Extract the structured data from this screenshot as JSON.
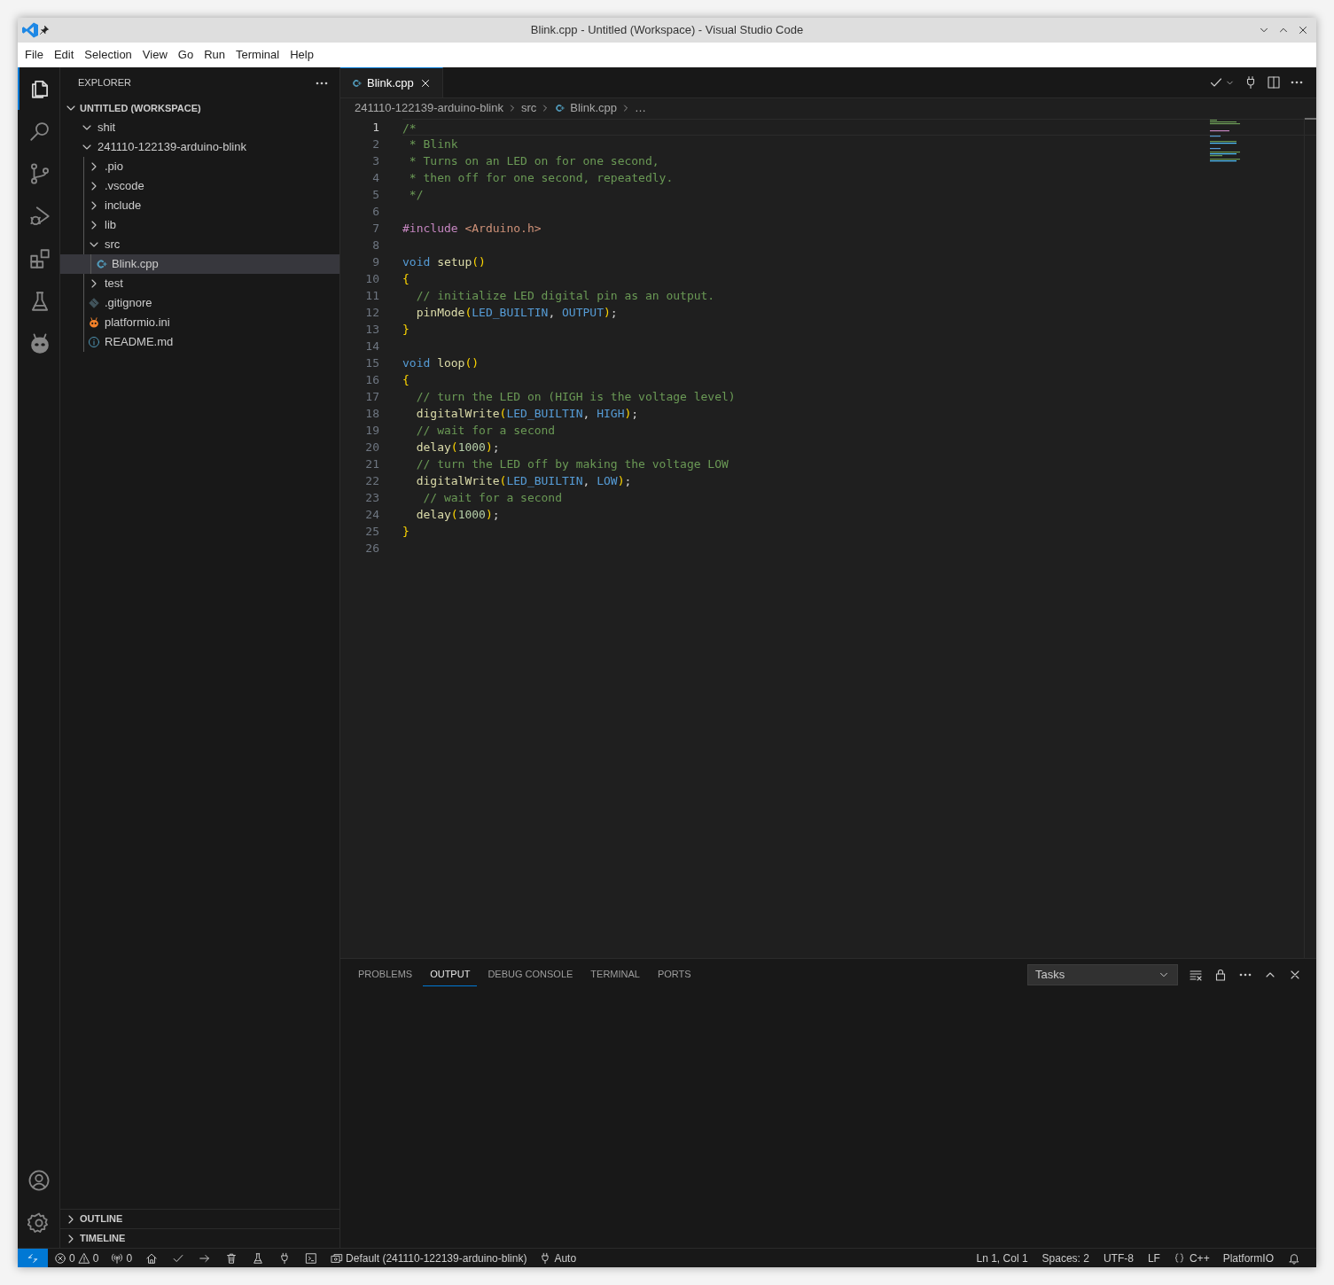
{
  "window": {
    "title": "Blink.cpp - Untitled (Workspace) - Visual Studio Code"
  },
  "menu": [
    "File",
    "Edit",
    "Selection",
    "View",
    "Go",
    "Run",
    "Terminal",
    "Help"
  ],
  "activity_bar": {
    "top": [
      {
        "selected": true
      },
      {
        "selected": false
      },
      {
        "selected": false
      },
      {
        "selected": false
      },
      {
        "selected": false
      },
      {
        "selected": false
      },
      {
        "selected": false
      }
    ]
  },
  "sidebar": {
    "title": "EXPLORER",
    "workspace": {
      "label": "UNTITLED (WORKSPACE)",
      "expanded": true
    },
    "tree": [
      {
        "label": "shit",
        "kind": "folder",
        "expanded": true,
        "selected": false
      },
      {
        "label": "241110-122139-arduino-blink",
        "kind": "folder",
        "expanded": true,
        "selected": false,
        "children": [
          {
            "label": ".pio",
            "kind": "folder",
            "expanded": false,
            "selected": false
          },
          {
            "label": ".vscode",
            "kind": "folder",
            "expanded": false,
            "selected": false
          },
          {
            "label": "include",
            "kind": "folder",
            "expanded": false,
            "selected": false
          },
          {
            "label": "lib",
            "kind": "folder",
            "expanded": false,
            "selected": false
          },
          {
            "label": "src",
            "kind": "folder",
            "expanded": true,
            "selected": false,
            "children": [
              {
                "label": "Blink.cpp",
                "kind": "cpp",
                "selected": true
              }
            ]
          },
          {
            "label": "test",
            "kind": "folder",
            "expanded": false,
            "selected": false
          },
          {
            "label": ".gitignore",
            "kind": "git",
            "selected": false
          },
          {
            "label": "platformio.ini",
            "kind": "pio",
            "selected": false
          },
          {
            "label": "README.md",
            "kind": "info",
            "selected": false
          }
        ]
      }
    ],
    "sections": [
      {
        "label": "OUTLINE",
        "expanded": false
      },
      {
        "label": "TIMELINE",
        "expanded": false
      }
    ]
  },
  "tabs": [
    {
      "label": "Blink.cpp",
      "selected": true
    }
  ],
  "breadcrumb": [
    {
      "text": "241110-122139-arduino-blink",
      "kind": "folder"
    },
    {
      "text": "src",
      "kind": "folder"
    },
    {
      "text": "Blink.cpp",
      "kind": "cpp"
    },
    {
      "text": "…",
      "kind": "more"
    }
  ],
  "code": [
    {
      "number": "1",
      "current": true,
      "tokens": [
        {
          "kind": "comment",
          "text": "/*"
        }
      ]
    },
    {
      "number": "2",
      "current": false,
      "tokens": [
        {
          "kind": "comment",
          "text": " * Blink"
        }
      ]
    },
    {
      "number": "3",
      "current": false,
      "tokens": [
        {
          "kind": "comment",
          "text": " * Turns on an LED on for one second,"
        }
      ]
    },
    {
      "number": "4",
      "current": false,
      "tokens": [
        {
          "kind": "comment",
          "text": " * then off for one second, repeatedly."
        }
      ]
    },
    {
      "number": "5",
      "current": false,
      "tokens": [
        {
          "kind": "comment",
          "text": " */"
        }
      ]
    },
    {
      "number": "6",
      "current": false
    },
    {
      "number": "7",
      "current": false,
      "tokens": [
        {
          "kind": "directive",
          "text": "#include "
        },
        {
          "kind": "string",
          "text": "<Arduino.h>"
        }
      ]
    },
    {
      "number": "8",
      "current": false
    },
    {
      "number": "9",
      "current": false,
      "tokens": [
        {
          "kind": "keyword",
          "text": "void "
        },
        {
          "kind": "function",
          "text": "setup"
        },
        {
          "kind": "bracket",
          "text": "()"
        }
      ]
    },
    {
      "number": "10",
      "current": false,
      "tokens": [
        {
          "kind": "bracket",
          "text": "{"
        }
      ]
    },
    {
      "number": "11",
      "current": false,
      "tokens": [
        {
          "kind": "comment",
          "text": "  // initialize LED digital pin as an output."
        }
      ]
    },
    {
      "number": "12",
      "current": false,
      "tokens": [
        {
          "kind": "function",
          "text": "  pinMode"
        },
        {
          "kind": "bracket",
          "text": "("
        },
        {
          "kind": "constant",
          "text": "LED_BUILTIN"
        },
        {
          "kind": "plain",
          "text": ", "
        },
        {
          "kind": "constant",
          "text": "OUTPUT"
        },
        {
          "kind": "bracket",
          "text": ")"
        },
        {
          "kind": "plain",
          "text": ";"
        }
      ]
    },
    {
      "number": "13",
      "current": false,
      "tokens": [
        {
          "kind": "bracket",
          "text": "}"
        }
      ]
    },
    {
      "number": "14",
      "current": false
    },
    {
      "number": "15",
      "current": false,
      "tokens": [
        {
          "kind": "keyword",
          "text": "void "
        },
        {
          "kind": "function",
          "text": "loop"
        },
        {
          "kind": "bracket",
          "text": "()"
        }
      ]
    },
    {
      "number": "16",
      "current": false,
      "tokens": [
        {
          "kind": "bracket",
          "text": "{"
        }
      ]
    },
    {
      "number": "17",
      "current": false,
      "tokens": [
        {
          "kind": "comment",
          "text": "  // turn the LED on (HIGH is the voltage level)"
        }
      ]
    },
    {
      "number": "18",
      "current": false,
      "tokens": [
        {
          "kind": "function",
          "text": "  digitalWrite"
        },
        {
          "kind": "bracket",
          "text": "("
        },
        {
          "kind": "constant",
          "text": "LED_BUILTIN"
        },
        {
          "kind": "plain",
          "text": ", "
        },
        {
          "kind": "constant",
          "text": "HIGH"
        },
        {
          "kind": "bracket",
          "text": ")"
        },
        {
          "kind": "plain",
          "text": ";"
        }
      ]
    },
    {
      "number": "19",
      "current": false,
      "tokens": [
        {
          "kind": "comment",
          "text": "  // wait for a second"
        }
      ]
    },
    {
      "number": "20",
      "current": false,
      "tokens": [
        {
          "kind": "function",
          "text": "  delay"
        },
        {
          "kind": "bracket",
          "text": "("
        },
        {
          "kind": "number",
          "text": "1000"
        },
        {
          "kind": "bracket",
          "text": ")"
        },
        {
          "kind": "plain",
          "text": ";"
        }
      ]
    },
    {
      "number": "21",
      "current": false,
      "tokens": [
        {
          "kind": "comment",
          "text": "  // turn the LED off by making the voltage LOW"
        }
      ]
    },
    {
      "number": "22",
      "current": false,
      "tokens": [
        {
          "kind": "function",
          "text": "  digitalWrite"
        },
        {
          "kind": "bracket",
          "text": "("
        },
        {
          "kind": "constant",
          "text": "LED_BUILTIN"
        },
        {
          "kind": "plain",
          "text": ", "
        },
        {
          "kind": "constant",
          "text": "LOW"
        },
        {
          "kind": "bracket",
          "text": ")"
        },
        {
          "kind": "plain",
          "text": ";"
        }
      ]
    },
    {
      "number": "23",
      "current": false,
      "tokens": [
        {
          "kind": "comment",
          "text": "   // wait for a second"
        }
      ]
    },
    {
      "number": "24",
      "current": false,
      "tokens": [
        {
          "kind": "function",
          "text": "  delay"
        },
        {
          "kind": "bracket",
          "text": "("
        },
        {
          "kind": "number",
          "text": "1000"
        },
        {
          "kind": "bracket",
          "text": ")"
        },
        {
          "kind": "plain",
          "text": ";"
        }
      ]
    },
    {
      "number": "25",
      "current": false,
      "tokens": [
        {
          "kind": "bracket",
          "text": "}"
        }
      ]
    },
    {
      "number": "26",
      "current": false
    }
  ],
  "panel": {
    "tabs": [
      {
        "label": "PROBLEMS",
        "selected": false
      },
      {
        "label": "OUTPUT",
        "selected": true
      },
      {
        "label": "DEBUG CONSOLE",
        "selected": false
      },
      {
        "label": "TERMINAL",
        "selected": false
      },
      {
        "label": "PORTS",
        "selected": false
      }
    ],
    "dropdown": "Tasks"
  },
  "status_bar": {
    "left": [
      {
        "kind": "remote"
      },
      {
        "kind": "problems",
        "errors": "0",
        "warnings": "0"
      },
      {
        "kind": "ports",
        "text": "0"
      },
      {
        "kind": "home"
      },
      {
        "kind": "check"
      },
      {
        "kind": "arrow"
      },
      {
        "kind": "trash"
      },
      {
        "kind": "flask"
      },
      {
        "kind": "plug"
      },
      {
        "kind": "terminal"
      },
      {
        "kind": "env",
        "text": "Default (241110-122139-arduino-blink)"
      },
      {
        "kind": "auto",
        "text": "Auto"
      }
    ],
    "right": [
      {
        "kind": "text",
        "text": "Ln 1, Col 1"
      },
      {
        "kind": "text",
        "text": "Spaces: 2"
      },
      {
        "kind": "text",
        "text": "UTF-8"
      },
      {
        "kind": "text",
        "text": "LF"
      },
      {
        "kind": "language",
        "text": "C++"
      },
      {
        "kind": "text",
        "text": "PlatformIO"
      },
      {
        "kind": "bell"
      }
    ]
  }
}
